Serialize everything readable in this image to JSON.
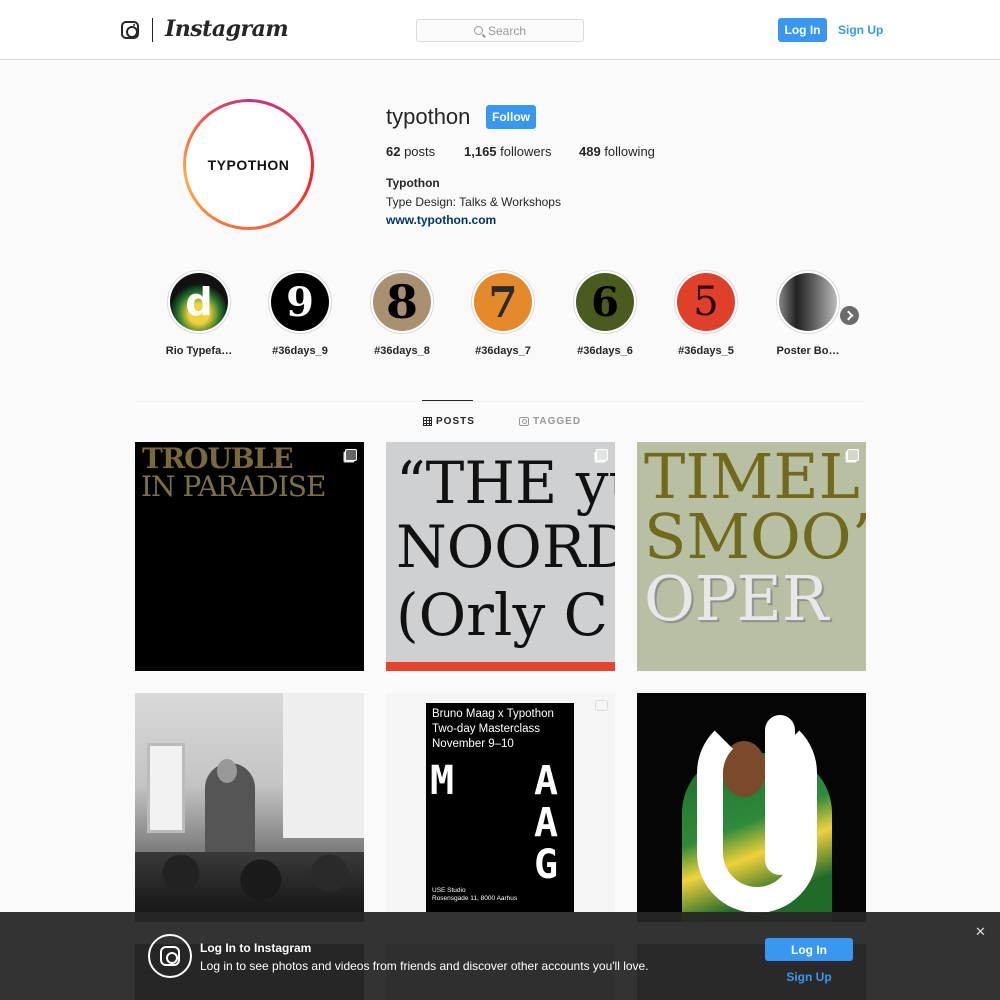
{
  "header": {
    "brand": "Instagram",
    "search_placeholder": "Search",
    "login_label": "Log In",
    "signup_label": "Sign Up"
  },
  "profile": {
    "avatar_text": "TYPOTHON",
    "username": "typothon",
    "follow_label": "Follow",
    "posts_count": "62",
    "posts_label": " posts",
    "followers_count": "1,165",
    "followers_label": " followers",
    "following_count": "489",
    "following_label": " following",
    "full_name": "Typothon",
    "bio": "Type Design: Talks & Workshops",
    "website": "www.typothon.com"
  },
  "highlights": [
    {
      "label": "Rio Typefa…",
      "glyph": "d"
    },
    {
      "label": "#36days_9",
      "glyph": "9"
    },
    {
      "label": "#36days_8",
      "glyph": "8"
    },
    {
      "label": "#36days_7",
      "glyph": "7"
    },
    {
      "label": "#36days_6",
      "glyph": "6"
    },
    {
      "label": "#36days_5",
      "glyph": "5"
    },
    {
      "label": "Poster Bo…",
      "glyph": ""
    }
  ],
  "tabs": {
    "posts": "POSTS",
    "tagged": "TAGGED"
  },
  "posts": {
    "p1": {
      "line1": "TROUBLE",
      "line2": "IN PARADISE"
    },
    "p2": {
      "line1": "“THE yu",
      "line2": "NOORDI",
      "line3": "(Orly C"
    },
    "p3": {
      "line1": "TIMEL",
      "line2": "SMOO’",
      "line3": "OPER"
    },
    "p5": {
      "line1": "Bruno Maag x Typothon",
      "line2": "Two-day Masterclass",
      "line3": "November 9–10",
      "letters": [
        "M",
        "A",
        "A",
        "G"
      ],
      "footer1": "USE Studio",
      "footer2": "Rosensgade 11, 8000 Aarhus"
    }
  },
  "banner": {
    "title": "Log In to Instagram",
    "description": "Log in to see photos and videos from friends and discover other accounts you'll love.",
    "login_label": "Log In",
    "signup_label": "Sign Up",
    "close": "✕"
  },
  "colors": {
    "accent": "#3897f0",
    "link": "#003569",
    "post3_olive": "#6f6a1c"
  }
}
